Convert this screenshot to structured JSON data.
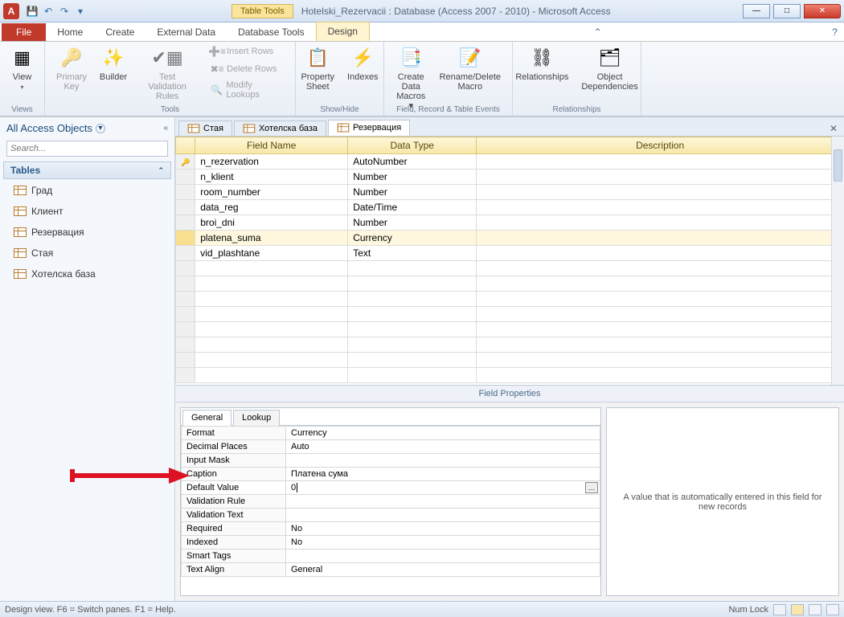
{
  "title": {
    "tools_context": "Table Tools",
    "window": "Hotelski_Rezervacii : Database (Access 2007 - 2010)  -  Microsoft Access",
    "app_letter": "A"
  },
  "ribbon": {
    "file": "File",
    "tabs": [
      "Home",
      "Create",
      "External Data",
      "Database Tools"
    ],
    "design": "Design",
    "groups": {
      "views": {
        "view": "View",
        "label": "Views"
      },
      "tools": {
        "primary_key": "Primary\nKey",
        "builder": "Builder",
        "test_rules": "Test Validation\nRules",
        "insert_rows": "Insert Rows",
        "delete_rows": "Delete Rows",
        "modify_lookups": "Modify Lookups",
        "label": "Tools"
      },
      "showhide": {
        "property_sheet": "Property\nSheet",
        "indexes": "Indexes",
        "label": "Show/Hide"
      },
      "events": {
        "create_macros": "Create Data\nMacros ▾",
        "rename_macro": "Rename/Delete\nMacro",
        "label": "Field, Record & Table Events"
      },
      "relationships": {
        "relationships": "Relationships",
        "deps": "Object\nDependencies",
        "label": "Relationships"
      }
    }
  },
  "nav": {
    "header": "All Access Objects",
    "search_placeholder": "Search...",
    "group": "Tables",
    "items": [
      "Град",
      "Клиент",
      "Резервация",
      "Стая",
      "Хотелска база"
    ]
  },
  "doc_tabs": {
    "t0": "Стая",
    "t1": "Хотелска база",
    "t2": "Резервация"
  },
  "grid": {
    "h_field": "Field Name",
    "h_type": "Data Type",
    "h_desc": "Description",
    "rows": [
      {
        "name": "n_rezervation",
        "type": "AutoNumber"
      },
      {
        "name": "n_klient",
        "type": "Number"
      },
      {
        "name": "room_number",
        "type": "Number"
      },
      {
        "name": "data_reg",
        "type": "Date/Time"
      },
      {
        "name": "broi_dni",
        "type": "Number"
      },
      {
        "name": "platena_suma",
        "type": "Currency"
      },
      {
        "name": "vid_plashtane",
        "type": "Text"
      }
    ]
  },
  "props": {
    "section_label": "Field Properties",
    "tab_general": "General",
    "tab_lookup": "Lookup",
    "rows": {
      "format_n": "Format",
      "format_v": "Currency",
      "decimal_n": "Decimal Places",
      "decimal_v": "Auto",
      "mask_n": "Input Mask",
      "mask_v": "",
      "caption_n": "Caption",
      "caption_v": "Платена сума",
      "default_n": "Default Value",
      "default_v": "0",
      "vrule_n": "Validation Rule",
      "vrule_v": "",
      "vtext_n": "Validation Text",
      "vtext_v": "",
      "req_n": "Required",
      "req_v": "No",
      "idx_n": "Indexed",
      "idx_v": "No",
      "smart_n": "Smart Tags",
      "smart_v": "",
      "align_n": "Text Align",
      "align_v": "General"
    },
    "help": "A value that is automatically entered in this field for new records"
  },
  "status": {
    "left": "Design view.  F6 = Switch panes.  F1 = Help.",
    "numlock": "Num Lock"
  }
}
